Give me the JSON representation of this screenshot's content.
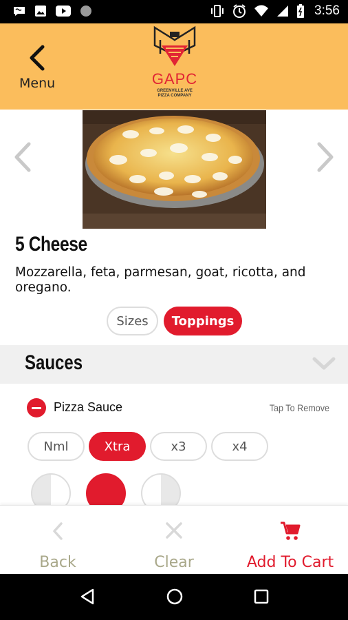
{
  "status_bar": {
    "time": "3:56"
  },
  "header": {
    "back_label": "Menu",
    "logo_name": "GAPC",
    "logo_subtitle_line1": "GREENVILLE AVE",
    "logo_subtitle_line2": "PIZZA COMPANY"
  },
  "product": {
    "title": "5 Cheese",
    "description": "Mozzarella, feta, parmesan, goat, ricotta, and oregano."
  },
  "tabs": [
    {
      "label": "Sizes",
      "active": false
    },
    {
      "label": "Toppings",
      "active": true
    }
  ],
  "section": {
    "title": "Sauces"
  },
  "topping": {
    "name": "Pizza Sauce",
    "hint": "Tap To Remove",
    "amounts": [
      {
        "label": "Nml",
        "active": false
      },
      {
        "label": "Xtra",
        "active": true
      },
      {
        "label": "x3",
        "active": false
      },
      {
        "label": "x4",
        "active": false
      }
    ],
    "portions": [
      "left-half",
      "whole",
      "right-half"
    ]
  },
  "actions": {
    "back_label": "Back",
    "clear_label": "Clear",
    "cart_label": "Add To Cart"
  },
  "colors": {
    "header_bg": "#fbbd5c",
    "accent_red": "#e11b2d",
    "muted_label": "#a9a88a"
  }
}
